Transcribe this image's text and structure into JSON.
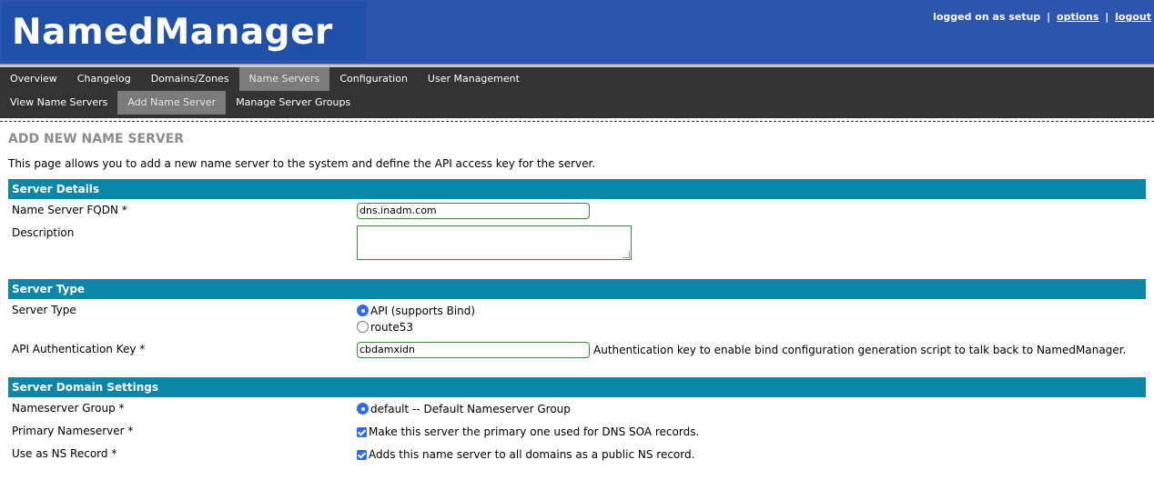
{
  "header": {
    "app_title": "NamedManager",
    "logged_on": "logged on as setup",
    "separator": "|",
    "options_label": "options",
    "logout_label": "logout"
  },
  "nav": {
    "primary": [
      "Overview",
      "Changelog",
      "Domains/Zones",
      "Name Servers",
      "Configuration",
      "User Management"
    ],
    "primary_active_index": 3,
    "secondary": [
      "View Name Servers",
      "Add Name Server",
      "Manage Server Groups"
    ],
    "secondary_active_index": 1
  },
  "page": {
    "title": "ADD NEW NAME SERVER",
    "intro": "This page allows you to add a new name server to the system and define the API access key for the server."
  },
  "sections": {
    "details": {
      "heading": "Server Details",
      "fqdn_label": "Name Server FQDN *",
      "fqdn_value": "dns.inadm.com",
      "description_label": "Description",
      "description_value": ""
    },
    "type": {
      "heading": "Server Type",
      "type_label": "Server Type",
      "option_api": "API (supports Bind)",
      "option_route53": "route53",
      "selected": "API (supports Bind)",
      "key_label": "API Authentication Key *",
      "key_value": "cbdamxidn",
      "key_hint": "Authentication key to enable bind configuration generation script to talk back to NamedManager."
    },
    "domain": {
      "heading": "Server Domain Settings",
      "group_label": "Nameserver Group *",
      "group_option": "default -- Default Nameserver Group",
      "primary_label": "Primary Nameserver *",
      "primary_text": "Make this server the primary one used for DNS SOA records.",
      "primary_checked": true,
      "ns_label": "Use as NS Record *",
      "ns_text": "Adds this name server to all domains as a public NS record.",
      "ns_checked": true
    }
  },
  "colors": {
    "header_bg": "#2d55ad",
    "nav_bg": "#333333",
    "section_bg": "#0a86a8",
    "accent": "#2d6cf2"
  }
}
